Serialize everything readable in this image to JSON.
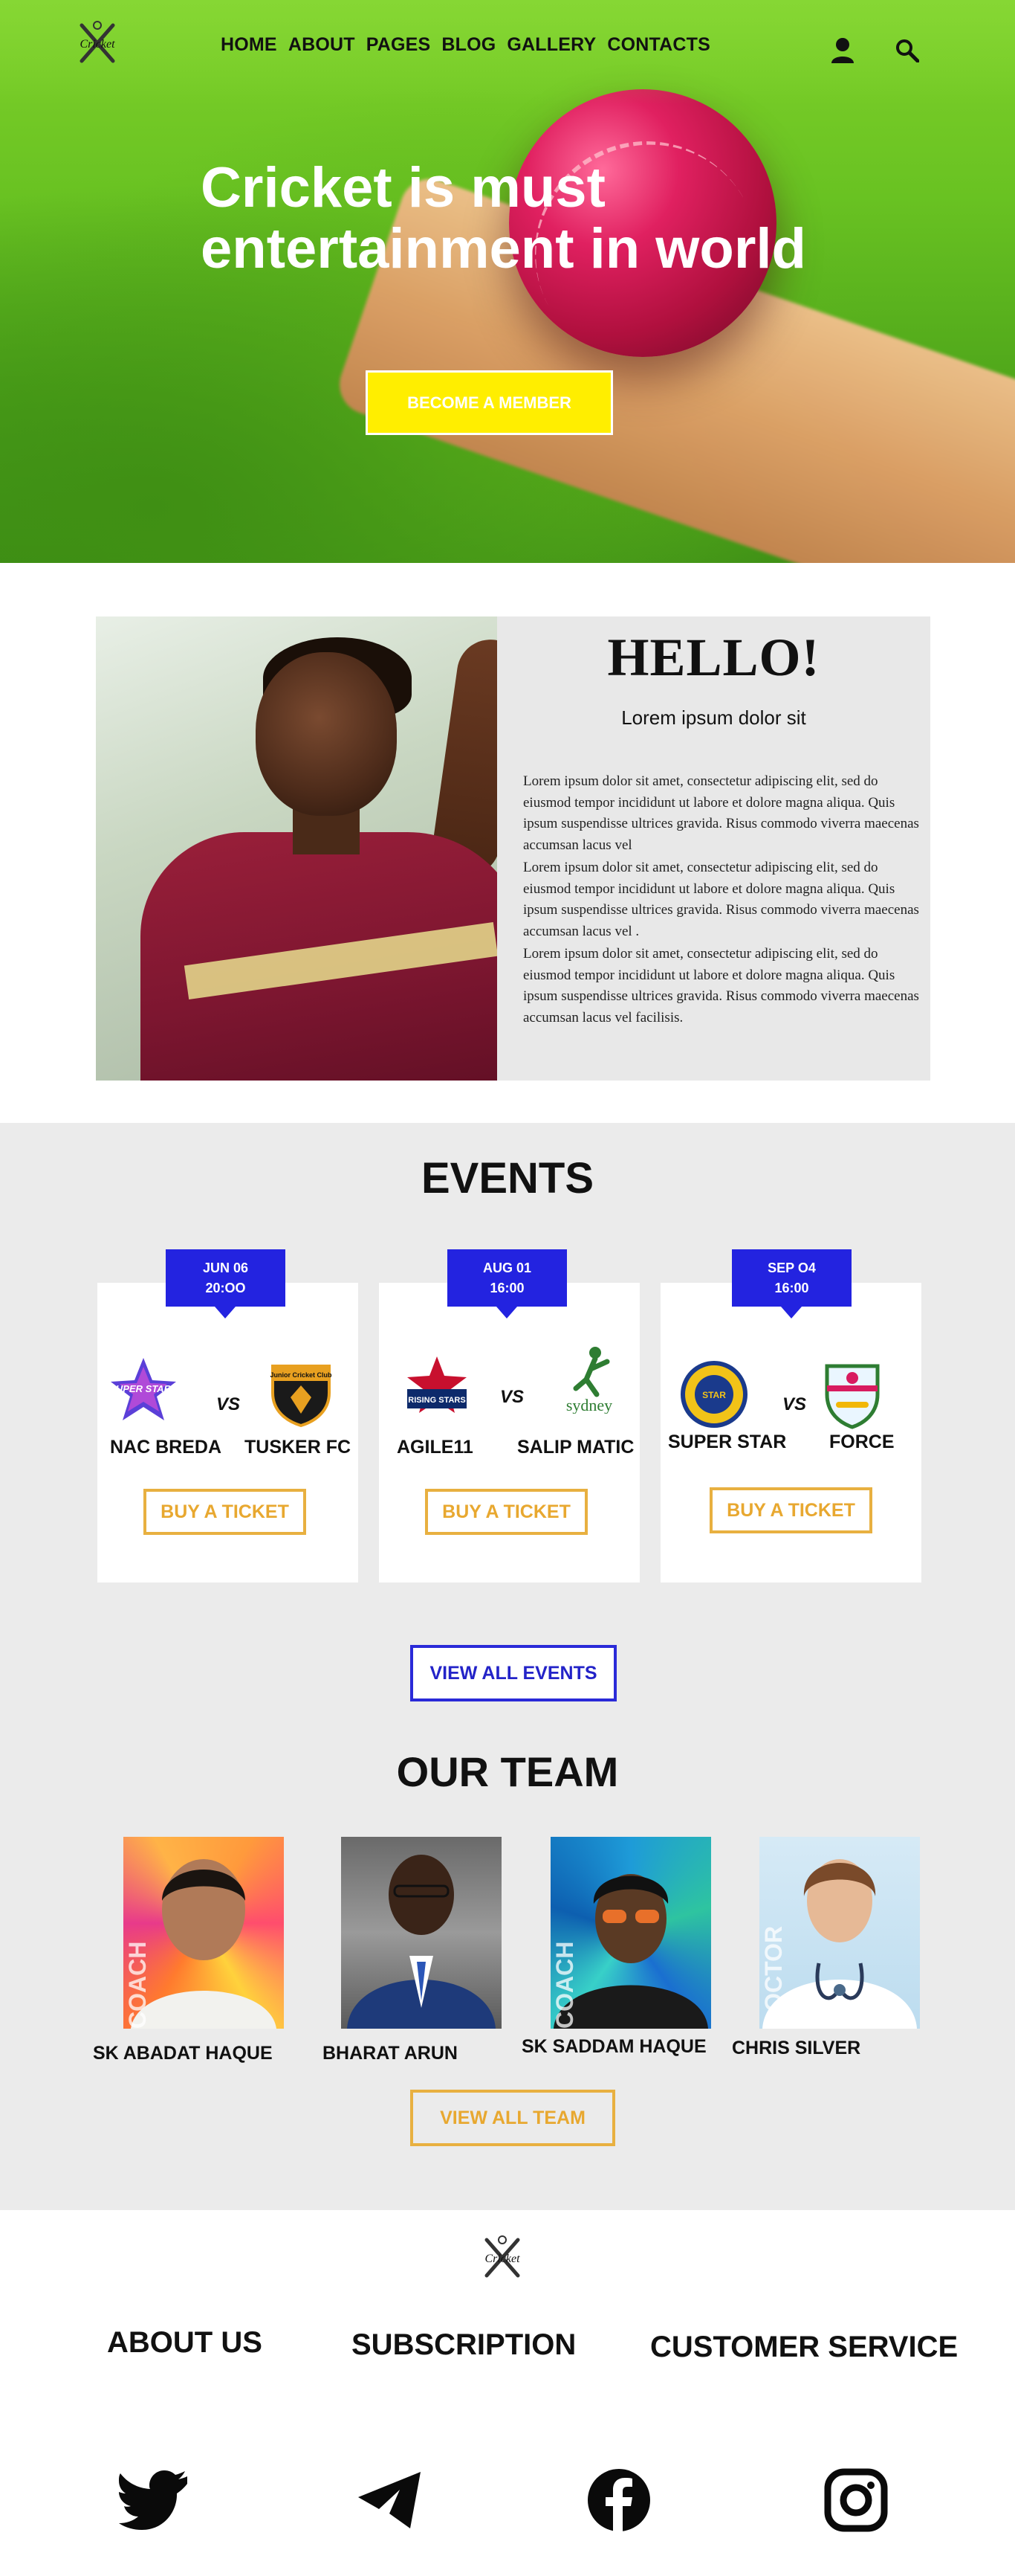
{
  "header": {
    "logo_label": "Cricket",
    "nav": [
      "HOME",
      "ABOUT",
      "PAGES",
      "BLOG",
      "GALLERY",
      "CONTACTS"
    ],
    "icons": [
      "user-icon",
      "search-icon"
    ]
  },
  "hero": {
    "title_line1": "Cricket  is must",
    "title_line2": "entertainment in world",
    "cta": "BECOME A MEMBER",
    "cta_color": "#ffee00"
  },
  "hello": {
    "title": "HELLO!",
    "subtitle": "Lorem ipsum dolor sit",
    "paragraphs": [
      "Lorem ipsum dolor sit amet, consectetur adipiscing elit, sed do eiusmod tempor incididunt ut labore et dolore magna aliqua. Quis ipsum suspendisse ultrices gravida. Risus commodo viverra maecenas accumsan lacus vel",
      "Lorem ipsum dolor sit amet, consectetur adipiscing elit, sed do eiusmod tempor incididunt ut labore et dolore magna aliqua. Quis ipsum suspendisse ultrices gravida. Risus commodo viverra maecenas accumsan lacus vel .",
      "Lorem ipsum dolor sit amet, consectetur adipiscing elit, sed do eiusmod tempor incididunt ut labore et dolore magna aliqua. Quis ipsum suspendisse ultrices gravida. Risus commodo viverra maecenas accumsan lacus vel facilisis."
    ]
  },
  "events": {
    "title": "EVENTS",
    "vs_label": "VS",
    "ticket_label": "BUY A TICKET",
    "items": [
      {
        "date": "JUN 06",
        "time": "20:OO",
        "team1": "NAC BREDA",
        "team2": "TUSKER FC",
        "logo1_text": "SUPER STARS",
        "logo2_text": "Junior Cricket Club"
      },
      {
        "date": "AUG 01",
        "time": "16:00",
        "team1": "AGILE11",
        "team2": "SALIP MATIC",
        "logo1_text": "RISING STARS",
        "logo2_text": "sydney"
      },
      {
        "date": "SEP O4",
        "time": "16:00",
        "team1": "SUPER STAR",
        "team2": "FORCE",
        "logo1_text": "STAR",
        "logo2_text": ""
      }
    ],
    "view_all": "VIEW ALL EVENTS",
    "accent_blue": "#2323e0",
    "accent_gold": "#e8b040"
  },
  "team": {
    "title": "OUR TEAM",
    "members": [
      {
        "name": "SK ABADAT HAQUE",
        "role": "COACH"
      },
      {
        "name": "BHARAT ARUN",
        "role": ""
      },
      {
        "name": "SK SADDAM HAQUE",
        "role": "COACH"
      },
      {
        "name": "CHRIS SILVER",
        "role": "DOCTOR"
      }
    ],
    "view_all": "VIEW ALL TEAM"
  },
  "footer": {
    "logo_label": "Cricket",
    "links": [
      "ABOUT US",
      "SUBSCRIPTION",
      "CUSTOMER SERVICE"
    ],
    "social": [
      "twitter-icon",
      "telegram-icon",
      "facebook-icon",
      "instagram-icon"
    ]
  }
}
